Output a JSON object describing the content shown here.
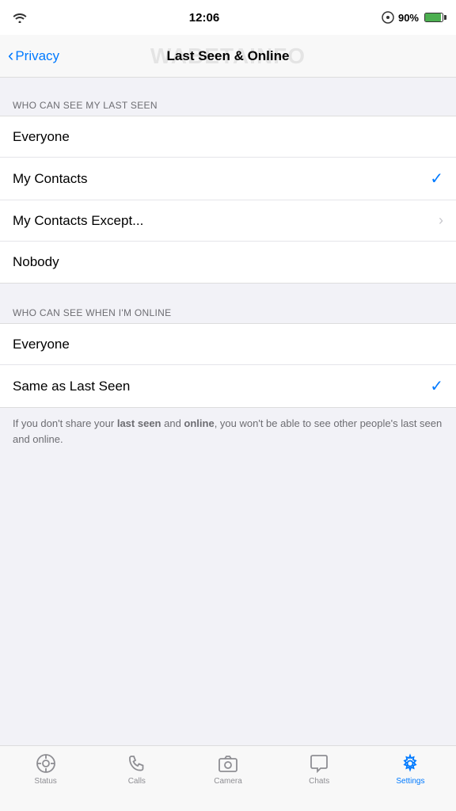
{
  "statusBar": {
    "time": "12:06",
    "battery": "90%",
    "batteryLevel": 90
  },
  "navBar": {
    "backLabel": "Privacy",
    "title": "Last Seen & Online"
  },
  "watermark": "WABETAINFO",
  "sections": [
    {
      "id": "last-seen",
      "header": "WHO CAN SEE MY LAST SEEN",
      "items": [
        {
          "id": "everyone-last",
          "label": "Everyone",
          "checked": false,
          "hasChevron": false
        },
        {
          "id": "my-contacts-last",
          "label": "My Contacts",
          "checked": true,
          "hasChevron": false
        },
        {
          "id": "contacts-except-last",
          "label": "My Contacts Except...",
          "checked": false,
          "hasChevron": true
        },
        {
          "id": "nobody-last",
          "label": "Nobody",
          "checked": false,
          "hasChevron": false
        }
      ]
    },
    {
      "id": "online",
      "header": "WHO CAN SEE WHEN I'M ONLINE",
      "items": [
        {
          "id": "everyone-online",
          "label": "Everyone",
          "checked": false,
          "hasChevron": false
        },
        {
          "id": "same-as-last-seen",
          "label": "Same as Last Seen",
          "checked": true,
          "hasChevron": false
        }
      ]
    }
  ],
  "infoText": {
    "prefix": "If you don't share your ",
    "term1": "last seen",
    "middle": " and ",
    "term2": "online",
    "suffix": ", you won't be able to see other people's last seen and online."
  },
  "tabBar": {
    "items": [
      {
        "id": "status",
        "label": "Status",
        "active": false
      },
      {
        "id": "calls",
        "label": "Calls",
        "active": false
      },
      {
        "id": "camera",
        "label": "Camera",
        "active": false
      },
      {
        "id": "chats",
        "label": "Chats",
        "active": false
      },
      {
        "id": "settings",
        "label": "Settings",
        "active": true
      }
    ]
  }
}
